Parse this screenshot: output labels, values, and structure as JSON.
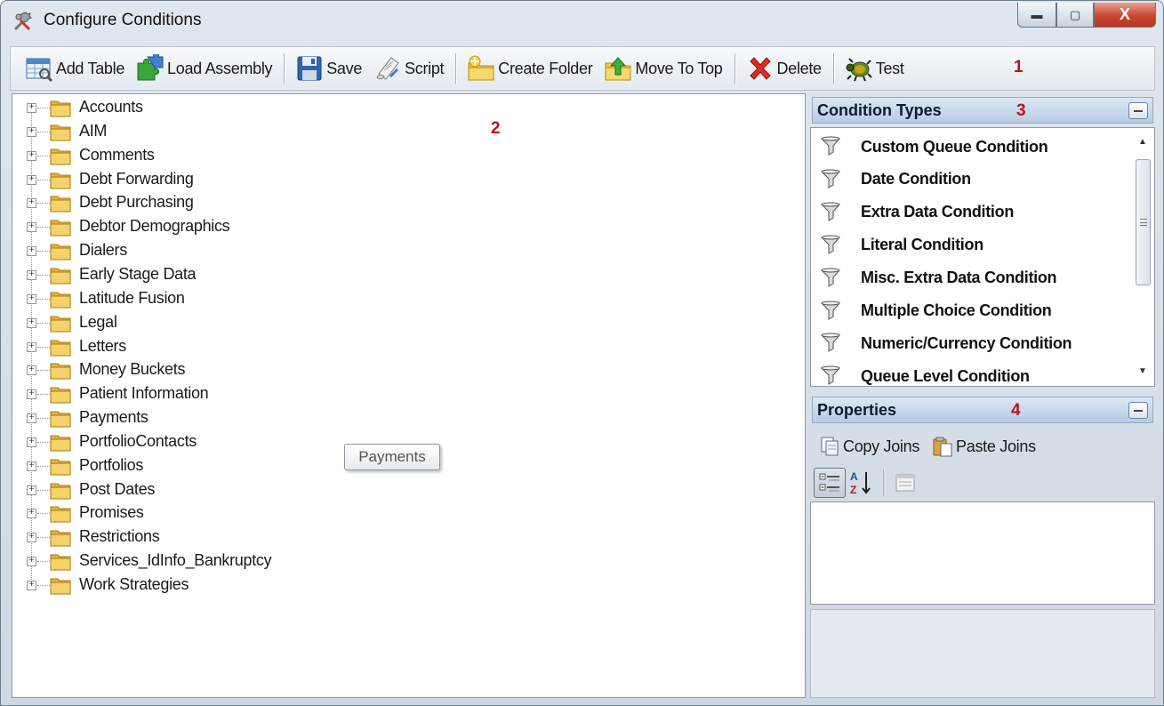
{
  "window": {
    "title": "Configure Conditions",
    "minimize_glyph": "▬",
    "maximize_glyph": "▢",
    "close_glyph": "X"
  },
  "toolbar": {
    "add_table": "Add Table",
    "load_assembly": "Load Assembly",
    "save": "Save",
    "script": "Script",
    "create_folder": "Create Folder",
    "move_to_top": "Move To Top",
    "delete": "Delete",
    "test": "Test"
  },
  "callouts": {
    "c1": "1",
    "c2": "2",
    "c3": "3",
    "c4": "4"
  },
  "tree": {
    "expander_glyph": "+",
    "items": [
      "Accounts",
      "AIM",
      "Comments",
      "Debt Forwarding",
      "Debt Purchasing",
      "Debtor Demographics",
      "Dialers",
      "Early Stage Data",
      "Latitude Fusion",
      "Legal",
      "Letters",
      "Money Buckets",
      "Patient Information",
      "Payments",
      "PortfolioContacts",
      "Portfolios",
      "Post Dates",
      "Promises",
      "Restrictions",
      "Services_IdInfo_Bankruptcy",
      "Work Strategies"
    ]
  },
  "tooltip": {
    "text": "Payments"
  },
  "condition_types": {
    "header": "Condition Types",
    "items": [
      "Custom Queue Condition",
      "Date Condition",
      "Extra Data Condition",
      "Literal Condition",
      "Misc. Extra Data Condition",
      "Multiple Choice Condition",
      "Numeric/Currency Condition",
      "Queue Level Condition"
    ],
    "scroll_up_glyph": "▲",
    "scroll_down_glyph": "▼"
  },
  "properties": {
    "header": "Properties",
    "copy_joins": "Copy Joins",
    "paste_joins": "Paste Joins"
  },
  "colors": {
    "accent_header": "#b6cbe3",
    "callout_red": "#c0101a",
    "folder_yellow": "#f2c94c"
  }
}
